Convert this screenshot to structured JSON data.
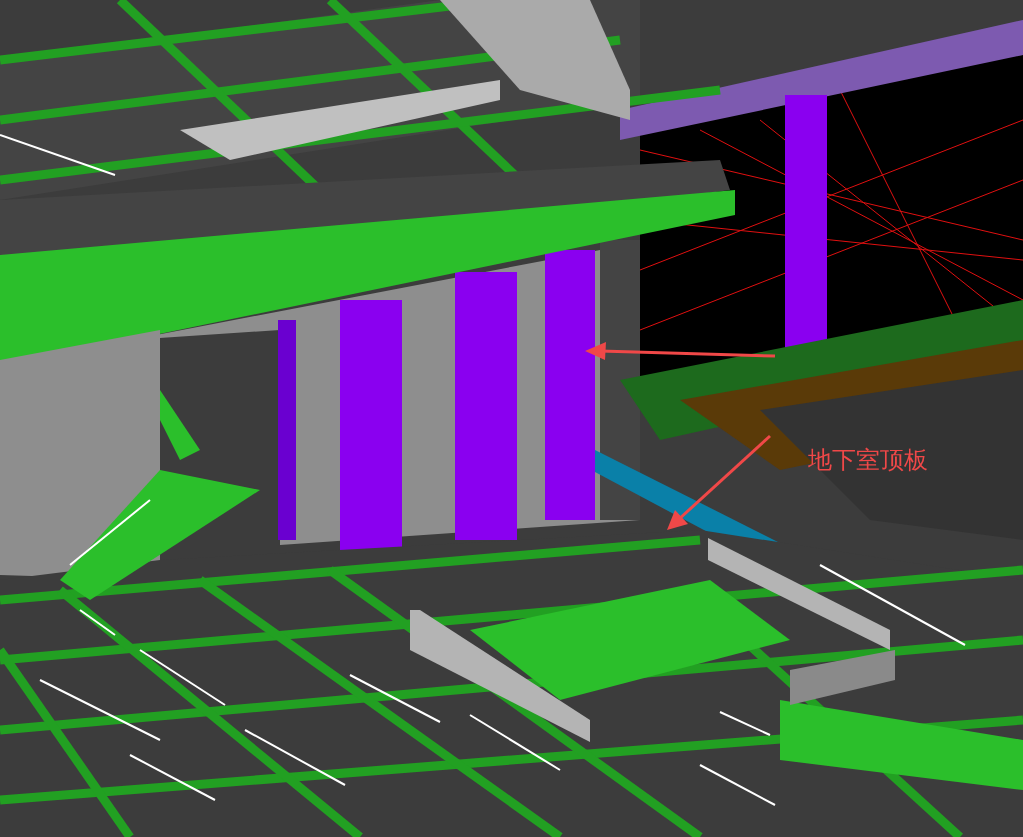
{
  "viewport": {
    "annotation": {
      "label": "地下室顶板"
    }
  }
}
